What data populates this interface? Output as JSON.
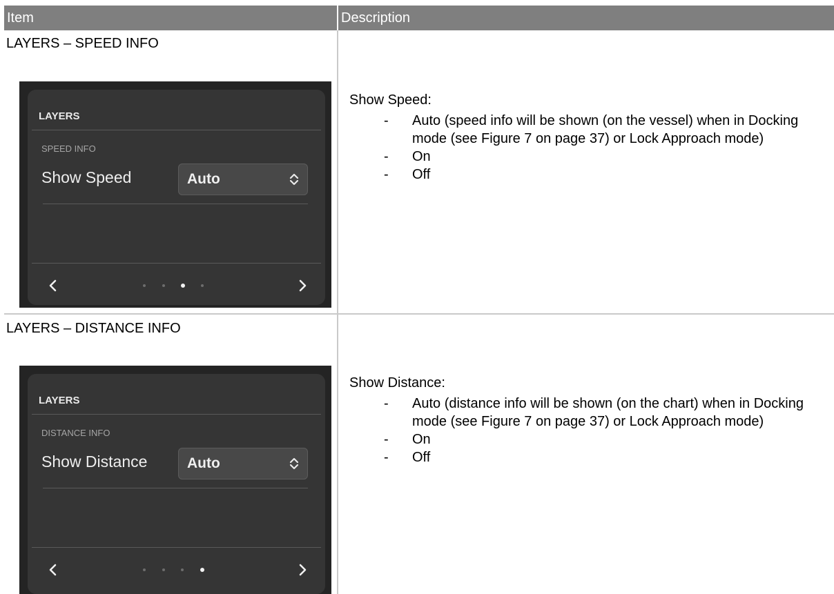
{
  "table": {
    "col_item": "Item",
    "col_description": "Description"
  },
  "rows": [
    {
      "item_title": "LAYERS – SPEED INFO",
      "panel": {
        "title": "LAYERS",
        "section": "SPEED INFO",
        "setting_label": "Show Speed",
        "selected_value": "Auto",
        "page_count": 4,
        "active_page": 3
      },
      "description": {
        "heading": "Show Speed:",
        "options": [
          "Auto (speed info will be shown (on the vessel) when in Docking mode (see Figure 7 on page 37) or Lock Approach mode)",
          "On",
          "Off"
        ]
      }
    },
    {
      "item_title": "LAYERS – DISTANCE INFO",
      "panel": {
        "title": "LAYERS",
        "section": "DISTANCE INFO",
        "setting_label": "Show Distance",
        "selected_value": "Auto",
        "page_count": 4,
        "active_page": 4
      },
      "description": {
        "heading": "Show Distance:",
        "options": [
          "Auto (distance info will be shown (on the chart) when in Docking mode (see Figure 7 on page 37) or Lock Approach mode)",
          "On",
          "Off"
        ]
      }
    }
  ],
  "icons": {
    "select": "up-down-chevron-icon",
    "prev": "chevron-left-icon",
    "next": "chevron-right-icon"
  },
  "colors": {
    "header_bg": "#7f7f7f",
    "panel_bg": "#353535",
    "panel_outer_bg": "#242424"
  }
}
